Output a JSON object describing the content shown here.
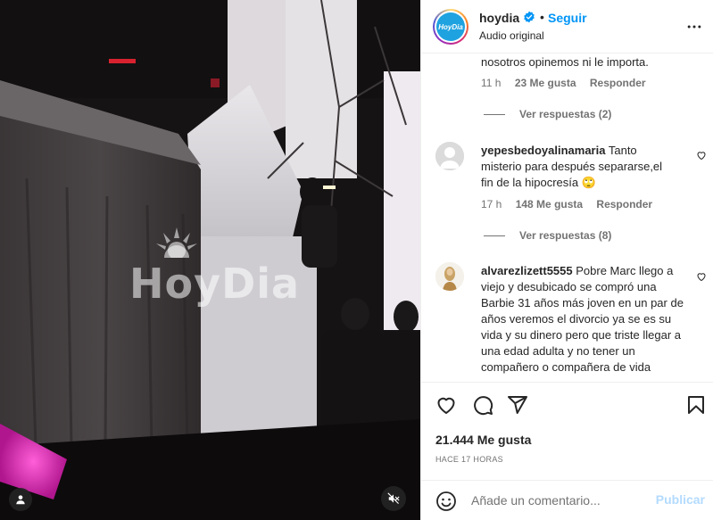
{
  "media": {
    "watermark": "HoyDia",
    "mute_icon": "speaker-muted-icon",
    "tag_icon": "user-tag-icon"
  },
  "header": {
    "username": "hoydia",
    "separator": "•",
    "follow_label": "Seguir",
    "audio_label": "Audio original",
    "avatar_text": "HoyDia",
    "verified_icon": "verified-badge-icon",
    "more_icon": "more-options-icon"
  },
  "comments": [
    {
      "username": "",
      "text": "nosotros opinemos ni le importa.",
      "time": "11 h",
      "likes": "23 Me gusta",
      "reply": "Responder",
      "view_replies": "Ver respuestas (2)"
    },
    {
      "username": "yepesbedoyalinamaria",
      "text": "Tanto misterio para después separarse,el fin de la hipocresía 🙄",
      "time": "17 h",
      "likes": "148 Me gusta",
      "reply": "Responder",
      "view_replies": "Ver respuestas (8)"
    },
    {
      "username": "alvarezlizett5555",
      "text": "Pobre Marc llego a viejo y desubicado se compró una Barbie 31 años más joven en un par de años veremos el divorcio ya se es su vida y su dinero pero que triste llegar a una edad adulta y no tener un compañero o compañera de vida"
    }
  ],
  "actions": {
    "icons": [
      "heart-icon",
      "comment-icon",
      "share-icon",
      "save-icon"
    ],
    "likes": "21.444 Me gusta",
    "time": "HACE 17 HORAS"
  },
  "composer": {
    "placeholder": "Añade un comentario...",
    "publish_label": "Publicar",
    "emoji_icon": "emoji-icon"
  },
  "colors": {
    "accent": "#0095f6",
    "publish_disabled": "#b3dbff",
    "muted_text": "#737373"
  }
}
